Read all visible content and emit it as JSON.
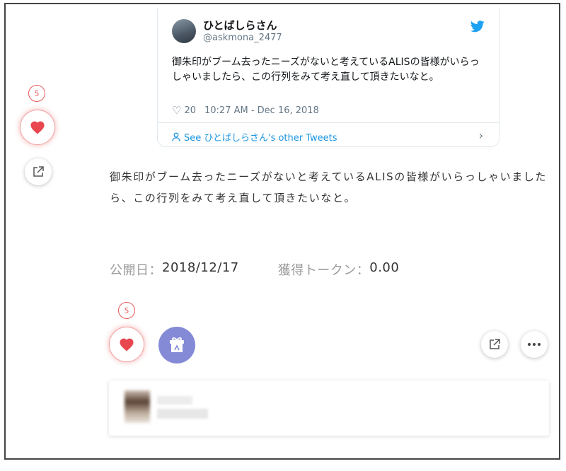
{
  "tweet": {
    "author_name": "ひとばしらさん",
    "author_handle": "@askmona_2477",
    "text": "御朱印がブーム去ったニーズがないと考えているALISの皆様がいらっしゃいましたら、この行列をみて考え直して頂きたいなと。",
    "like_count": "20",
    "timestamp": "10:27 AM - Dec 16, 2018",
    "see_more": "See ひとばしらさん's other Tweets",
    "icons": {
      "bird": "twitter-bird-icon",
      "heart": "heart-outline-icon",
      "person": "person-icon",
      "chevron": "chevron-right-icon"
    },
    "colors": {
      "link": "#1b95e0",
      "bird": "#1da1f2"
    }
  },
  "sidebar": {
    "like_count": "5"
  },
  "article": {
    "body": "御朱印がブーム去ったニーズがないと考えているALISの皆様がいらっしゃいましたら、この行列をみて考え直して頂きたいなと。",
    "published_label": "公開日：",
    "published_value": "2018/12/17",
    "tokens_label": "獲得トークン：",
    "tokens_value": "0.00"
  },
  "actions": {
    "like_count": "5",
    "colors": {
      "like": "#e8474f",
      "gift": "#858ad6"
    },
    "icons": {
      "like": "heart-icon",
      "gift": "gift-icon",
      "share": "share-icon",
      "more": "more-icon"
    }
  }
}
